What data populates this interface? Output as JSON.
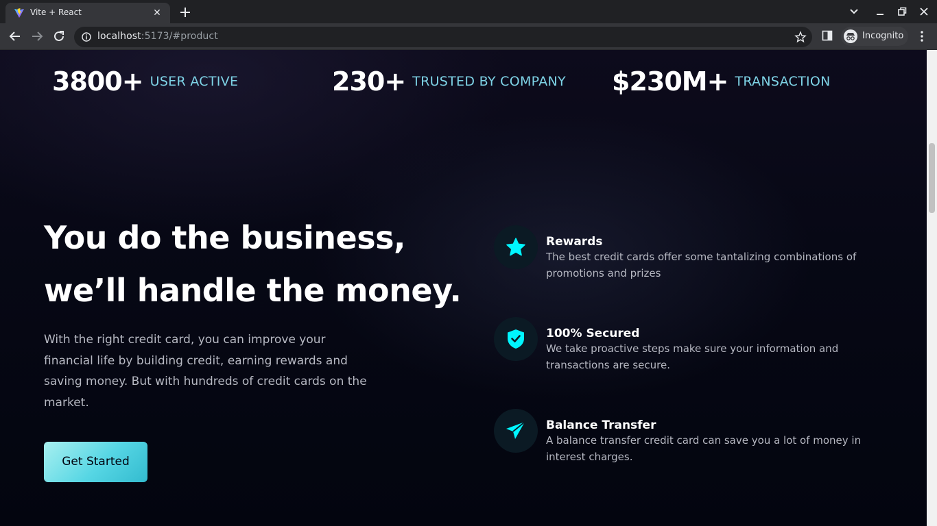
{
  "browser": {
    "tab_title": "Vite + React",
    "url_host": "localhost",
    "url_rest": ":5173/#product",
    "incognito_label": "Incognito"
  },
  "stats": [
    {
      "value": "3800+",
      "label": "USER ACTIVE"
    },
    {
      "value": "230+",
      "label": "TRUSTED BY COMPANY"
    },
    {
      "value": "$230M+",
      "label": "TRANSACTION"
    }
  ],
  "business": {
    "headline_line1": "You do the business,",
    "headline_line2": "we’ll handle the money.",
    "paragraph": "With the right credit card, you can improve your financial life by building credit, earning rewards and saving money. But with hundreds of credit cards on the market.",
    "cta_label": "Get Started"
  },
  "features": [
    {
      "icon": "star-icon",
      "title": "Rewards",
      "description": "The best credit cards offer some tantalizing combinations of promotions and prizes"
    },
    {
      "icon": "shield-icon",
      "title": "100% Secured",
      "description": "We take proactive steps make sure your information and transactions are secure."
    },
    {
      "icon": "send-icon",
      "title": "Balance Transfer",
      "description": "A balance transfer credit card can save you a lot of money in interest charges."
    }
  ],
  "colors": {
    "accent": "#33bbcf",
    "icon_cyan": "#00f6ff",
    "background": "#00040f",
    "label_cyan": "#7ed3e6"
  }
}
